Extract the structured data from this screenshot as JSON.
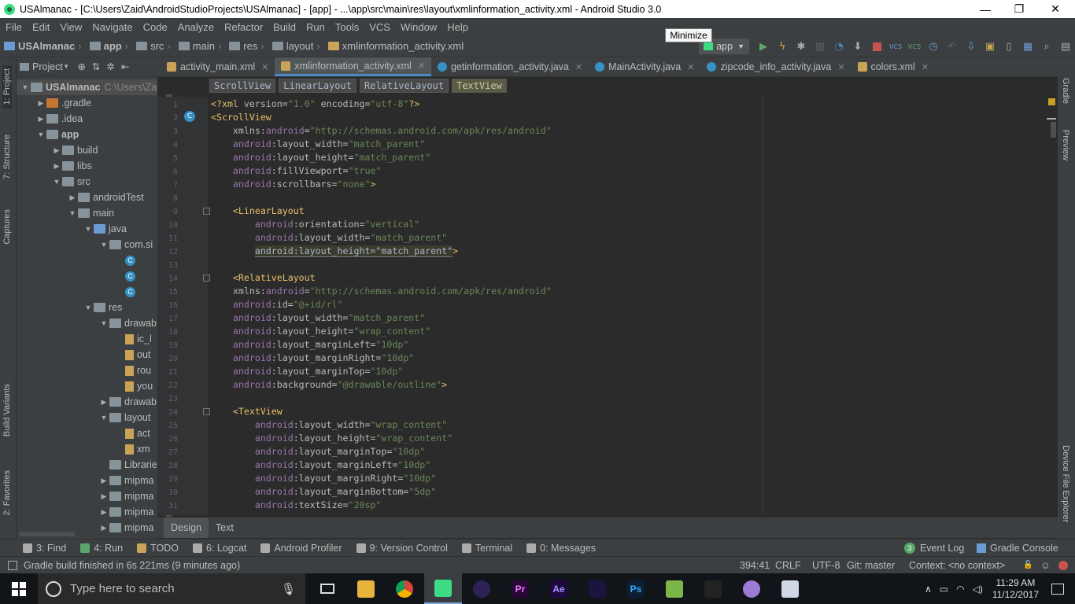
{
  "window": {
    "title": "USAlmanac - [C:\\Users\\Zaid\\AndroidStudioProjects\\USAlmanac] - [app] - ...\\app\\src\\main\\res\\layout\\xmlinformation_activity.xml - Android Studio 3.0",
    "minimize": "—",
    "restore": "❐",
    "close": "✕",
    "tooltip": "Minimize"
  },
  "menu": [
    "File",
    "Edit",
    "View",
    "Navigate",
    "Code",
    "Analyze",
    "Refactor",
    "Build",
    "Run",
    "Tools",
    "VCS",
    "Window",
    "Help"
  ],
  "breadcrumbs": [
    "USAlmanac",
    "app",
    "src",
    "main",
    "res",
    "layout",
    "xmlinformation_activity.xml"
  ],
  "run_config": "app",
  "project_panel": {
    "title": "Project",
    "rows": [
      {
        "label": "USAlmanac",
        "extra": "C:\\Users\\Za",
        "type": "folder",
        "depth": 0,
        "arrow": "▼",
        "bold": true
      },
      {
        "label": ".gradle",
        "type": "orange",
        "depth": 1,
        "arrow": "▶"
      },
      {
        "label": ".idea",
        "type": "folder",
        "depth": 1,
        "arrow": "▶"
      },
      {
        "label": "app",
        "type": "folder",
        "depth": 1,
        "arrow": "▼",
        "bold": true
      },
      {
        "label": "build",
        "type": "folder",
        "depth": 2,
        "arrow": "▶"
      },
      {
        "label": "libs",
        "type": "folder",
        "depth": 2,
        "arrow": "▶"
      },
      {
        "label": "src",
        "type": "folder",
        "depth": 2,
        "arrow": "▼"
      },
      {
        "label": "androidTest",
        "type": "folder",
        "depth": 3,
        "arrow": "▶"
      },
      {
        "label": "main",
        "type": "folder",
        "depth": 3,
        "arrow": "▼"
      },
      {
        "label": "java",
        "type": "blue",
        "depth": 4,
        "arrow": "▼"
      },
      {
        "label": "com.si",
        "type": "folder",
        "depth": 5,
        "arrow": "▼"
      },
      {
        "label": "",
        "type": "class",
        "depth": 6,
        "arrow": ""
      },
      {
        "label": "",
        "type": "class",
        "depth": 6,
        "arrow": ""
      },
      {
        "label": "",
        "type": "class",
        "depth": 6,
        "arrow": ""
      },
      {
        "label": "res",
        "type": "folder",
        "depth": 4,
        "arrow": "▼"
      },
      {
        "label": "drawab",
        "type": "folder",
        "depth": 5,
        "arrow": "▼"
      },
      {
        "label": "ic_l",
        "type": "file",
        "depth": 6,
        "arrow": ""
      },
      {
        "label": "out",
        "type": "file",
        "depth": 6,
        "arrow": ""
      },
      {
        "label": "rou",
        "type": "file",
        "depth": 6,
        "arrow": ""
      },
      {
        "label": "you",
        "type": "file",
        "depth": 6,
        "arrow": ""
      },
      {
        "label": "drawab",
        "type": "folder",
        "depth": 5,
        "arrow": "▶"
      },
      {
        "label": "layout",
        "type": "folder",
        "depth": 5,
        "arrow": "▼"
      },
      {
        "label": "act",
        "type": "file",
        "depth": 6,
        "arrow": ""
      },
      {
        "label": "xm",
        "type": "file",
        "depth": 6,
        "arrow": ""
      },
      {
        "label": "Librarie",
        "type": "folder",
        "depth": 5,
        "arrow": ""
      },
      {
        "label": "mipma",
        "type": "folder",
        "depth": 5,
        "arrow": "▶"
      },
      {
        "label": "mipma",
        "type": "folder",
        "depth": 5,
        "arrow": "▶"
      },
      {
        "label": "mipma",
        "type": "folder",
        "depth": 5,
        "arrow": "▶"
      },
      {
        "label": "mipma",
        "type": "folder",
        "depth": 5,
        "arrow": "▶"
      }
    ]
  },
  "left_strip": [
    "1: Project",
    "7: Structure",
    "Captures",
    "Build Variants",
    "2: Favorites"
  ],
  "right_strip": [
    "Gradle",
    "Preview",
    "Device File Explorer"
  ],
  "editor_tabs": [
    {
      "label": "activity_main.xml",
      "icon": "#c9a357",
      "active": false
    },
    {
      "label": "xmlinformation_activity.xml",
      "icon": "#c9a357",
      "active": true
    },
    {
      "label": "getinformation_activity.java",
      "icon": "#3592c4",
      "active": false
    },
    {
      "label": "MainActivity.java",
      "icon": "#3592c4",
      "active": false
    },
    {
      "label": "zipcode_info_activity.java",
      "icon": "#3592c4",
      "active": false
    },
    {
      "label": "colors.xml",
      "icon": "#c9a357",
      "active": false
    }
  ],
  "xml_breadcrumbs": [
    "ScrollView",
    "LinearLayout",
    "RelativeLayout",
    "TextView"
  ],
  "code_lines": [
    [
      [
        "t",
        "<?xml "
      ],
      [
        "a",
        "version="
      ],
      [
        "v",
        "\"1.0\""
      ],
      [
        "a",
        " encoding="
      ],
      [
        "v",
        "\"utf-8\""
      ],
      [
        "t",
        "?>"
      ]
    ],
    [
      [
        "t",
        "<ScrollView"
      ]
    ],
    [
      [
        "a",
        "    xmlns:"
      ],
      [
        "n",
        "android"
      ],
      [
        "a",
        "="
      ],
      [
        "v",
        "\"http://schemas.android.com/apk/res/android\""
      ]
    ],
    [
      [
        "n",
        "    android"
      ],
      [
        "a",
        ":layout_width="
      ],
      [
        "v",
        "\"match_parent\""
      ]
    ],
    [
      [
        "n",
        "    android"
      ],
      [
        "a",
        ":layout_height="
      ],
      [
        "v",
        "\"match_parent\""
      ]
    ],
    [
      [
        "n",
        "    android"
      ],
      [
        "a",
        ":fillViewport="
      ],
      [
        "v",
        "\"true\""
      ]
    ],
    [
      [
        "n",
        "    android"
      ],
      [
        "a",
        ":scrollbars="
      ],
      [
        "v",
        "\"none\""
      ],
      [
        "t",
        ">"
      ]
    ],
    [
      [
        "a",
        ""
      ]
    ],
    [
      [
        "t",
        "    <LinearLayout"
      ]
    ],
    [
      [
        "n",
        "        android"
      ],
      [
        "a",
        ":orientation="
      ],
      [
        "v",
        "\"vertical\""
      ]
    ],
    [
      [
        "n",
        "        android"
      ],
      [
        "a",
        ":layout_width="
      ],
      [
        "v",
        "\"match_parent\""
      ]
    ],
    [
      [
        "a",
        "        "
      ],
      [
        "h",
        "android:layout_height=\"match_parent\""
      ],
      [
        "t",
        ">"
      ]
    ],
    [
      [
        "a",
        ""
      ]
    ],
    [
      [
        "t",
        "    <RelativeLayout"
      ]
    ],
    [
      [
        "a",
        "    xmlns:"
      ],
      [
        "n",
        "android"
      ],
      [
        "a",
        "="
      ],
      [
        "v",
        "\"http://schemas.android.com/apk/res/android\""
      ]
    ],
    [
      [
        "n",
        "    android"
      ],
      [
        "a",
        ":id="
      ],
      [
        "v",
        "\"@+id/rl\""
      ]
    ],
    [
      [
        "n",
        "    android"
      ],
      [
        "a",
        ":layout_width="
      ],
      [
        "v",
        "\"match_parent\""
      ]
    ],
    [
      [
        "n",
        "    android"
      ],
      [
        "a",
        ":layout_height="
      ],
      [
        "v",
        "\"wrap_content\""
      ]
    ],
    [
      [
        "n",
        "    android"
      ],
      [
        "a",
        ":layout_marginLeft="
      ],
      [
        "v",
        "\"10dp\""
      ]
    ],
    [
      [
        "n",
        "    android"
      ],
      [
        "a",
        ":layout_marginRight="
      ],
      [
        "v",
        "\"10dp\""
      ]
    ],
    [
      [
        "n",
        "    android"
      ],
      [
        "a",
        ":layout_marginTop="
      ],
      [
        "v",
        "\"10dp\""
      ]
    ],
    [
      [
        "n",
        "    android"
      ],
      [
        "a",
        ":background="
      ],
      [
        "v",
        "\"@drawable/outline\""
      ],
      [
        "t",
        ">"
      ]
    ],
    [
      [
        "a",
        ""
      ]
    ],
    [
      [
        "t",
        "    <TextView"
      ]
    ],
    [
      [
        "n",
        "        android"
      ],
      [
        "a",
        ":layout_width="
      ],
      [
        "v",
        "\"wrap_content\""
      ]
    ],
    [
      [
        "n",
        "        android"
      ],
      [
        "a",
        ":layout_height="
      ],
      [
        "v",
        "\"wrap_content\""
      ]
    ],
    [
      [
        "n",
        "        android"
      ],
      [
        "a",
        ":layout_marginTop="
      ],
      [
        "v",
        "\"10dp\""
      ]
    ],
    [
      [
        "n",
        "        android"
      ],
      [
        "a",
        ":layout_marginLeft="
      ],
      [
        "v",
        "\"10dp\""
      ]
    ],
    [
      [
        "n",
        "        android"
      ],
      [
        "a",
        ":layout_marginRight="
      ],
      [
        "v",
        "\"10dp\""
      ]
    ],
    [
      [
        "n",
        "        android"
      ],
      [
        "a",
        ":layout_marginBottom="
      ],
      [
        "v",
        "\"5dp\""
      ]
    ],
    [
      [
        "n",
        "        android"
      ],
      [
        "a",
        ":textSize="
      ],
      [
        "v",
        "\"20sp\""
      ]
    ]
  ],
  "bottom_tabs": {
    "design": "Design",
    "text": "Text"
  },
  "tool_windows": [
    {
      "label": "3: Find",
      "icon": "#aaa"
    },
    {
      "label": "4: Run",
      "icon": "#59a869"
    },
    {
      "label": "TODO",
      "icon": "#c9a357"
    },
    {
      "label": "6: Logcat",
      "icon": "#aaa"
    },
    {
      "label": "Android Profiler",
      "icon": "#aaa"
    },
    {
      "label": "9: Version Control",
      "icon": "#aaa"
    },
    {
      "label": "Terminal",
      "icon": "#aaa"
    },
    {
      "label": "0: Messages",
      "icon": "#aaa"
    }
  ],
  "event_log": {
    "badge": "3",
    "label": "Event Log"
  },
  "gradle_console": "Gradle Console",
  "status": {
    "message": "Gradle build finished in 6s 221ms (9 minutes ago)",
    "position": "394:41",
    "line_sep": "CRLF",
    "encoding": "UTF-8",
    "git": "Git: master",
    "context": "Context: <no context>"
  },
  "taskbar": {
    "search_placeholder": "Type here to search",
    "apps": [
      {
        "name": "file-explorer",
        "bg": "#e8b53c",
        "txt": ""
      },
      {
        "name": "chrome",
        "bg": "#dd4b39",
        "txt": ""
      },
      {
        "name": "android-studio",
        "bg": "#3ddc84",
        "txt": ""
      },
      {
        "name": "eclipse",
        "bg": "#2c2255",
        "txt": ""
      },
      {
        "name": "premiere",
        "bg": "#2a0634",
        "txt": "Pr"
      },
      {
        "name": "after-effects",
        "bg": "#1f0740",
        "txt": "Ae"
      },
      {
        "name": "media-encoder",
        "bg": "#1b1340",
        "txt": ""
      },
      {
        "name": "photoshop",
        "bg": "#0a1f33",
        "txt": "Ps"
      },
      {
        "name": "notepad",
        "bg": "#7ab648",
        "txt": ""
      },
      {
        "name": "unity",
        "bg": "#222",
        "txt": ""
      },
      {
        "name": "github",
        "bg": "#9c7bd6",
        "txt": ""
      },
      {
        "name": "remote-desktop",
        "bg": "#cfd8e3",
        "txt": ""
      }
    ],
    "time": "11:29 AM",
    "date": "11/12/2017"
  },
  "colors": {
    "accent": "#4a88c7",
    "tag": "#e8bf6a",
    "value": "#6a8759",
    "namespace": "#9876aa"
  }
}
